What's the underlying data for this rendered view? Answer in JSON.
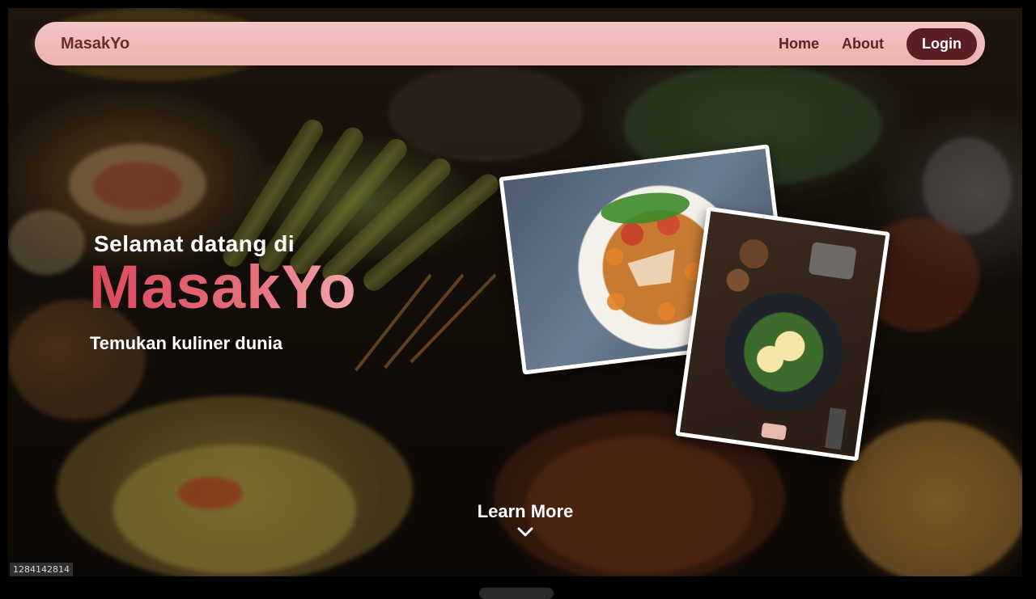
{
  "navbar": {
    "brand": "MasakYo",
    "links": [
      {
        "label": "Home"
      },
      {
        "label": "About"
      }
    ],
    "login_label": "Login"
  },
  "hero": {
    "greeting": "Selamat datang di",
    "title": "MasakYo",
    "subtitle": "Temukan kuliner dunia"
  },
  "cta": {
    "label": "Learn More",
    "icon": "chevron-down-icon"
  },
  "photos": [
    {
      "subject": "fried noodles plate"
    },
    {
      "subject": "egg and avocado salad"
    }
  ],
  "background": {
    "subject": "Indonesian food spread",
    "image_id": "1284142814"
  },
  "colors": {
    "navbar_bg": "#efbdbb",
    "brand_text": "#6b2b2b",
    "login_bg": "#5a1f22",
    "title_gradient_start": "#d9485c",
    "title_gradient_end": "#f1a8ad"
  }
}
